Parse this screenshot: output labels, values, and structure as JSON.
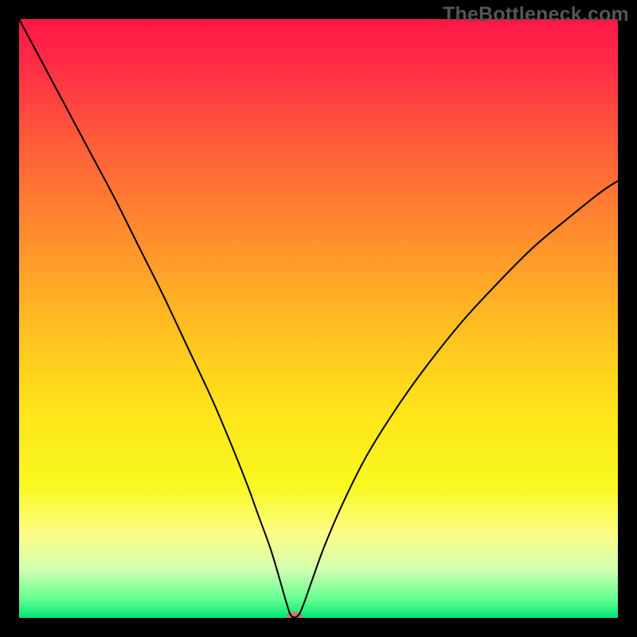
{
  "watermark": "TheBottleneck.com",
  "chart_data": {
    "type": "line",
    "title": "",
    "xlabel": "",
    "ylabel": "",
    "xlim": [
      0,
      100
    ],
    "ylim": [
      0,
      100
    ],
    "grid": false,
    "background_gradient": {
      "type": "vertical",
      "stops": [
        {
          "pos": 0.0,
          "color": "#ff1744"
        },
        {
          "pos": 0.07,
          "color": "#ff2a47"
        },
        {
          "pos": 0.2,
          "color": "#ff5a3a"
        },
        {
          "pos": 0.35,
          "color": "#ff8a2e"
        },
        {
          "pos": 0.5,
          "color": "#ffba22"
        },
        {
          "pos": 0.65,
          "color": "#ffe31a"
        },
        {
          "pos": 0.78,
          "color": "#f8f820"
        },
        {
          "pos": 0.86,
          "color": "#fdfd88"
        },
        {
          "pos": 0.92,
          "color": "#d0ffb0"
        },
        {
          "pos": 0.97,
          "color": "#60ff90"
        },
        {
          "pos": 1.0,
          "color": "#00e676"
        }
      ]
    },
    "series": [
      {
        "name": "bottleneck-curve",
        "color": "#000000",
        "stroke_width": 2,
        "points": [
          {
            "x": 0.0,
            "y": 100.0
          },
          {
            "x": 4.0,
            "y": 92.5
          },
          {
            "x": 8.0,
            "y": 85.0
          },
          {
            "x": 12.0,
            "y": 77.5
          },
          {
            "x": 16.0,
            "y": 70.0
          },
          {
            "x": 20.0,
            "y": 62.0
          },
          {
            "x": 24.0,
            "y": 54.0
          },
          {
            "x": 28.0,
            "y": 45.5
          },
          {
            "x": 32.0,
            "y": 37.0
          },
          {
            "x": 35.0,
            "y": 30.0
          },
          {
            "x": 38.0,
            "y": 22.5
          },
          {
            "x": 40.0,
            "y": 17.0
          },
          {
            "x": 42.0,
            "y": 11.5
          },
          {
            "x": 43.5,
            "y": 6.5
          },
          {
            "x": 44.8,
            "y": 2.0
          },
          {
            "x": 45.5,
            "y": 0.3
          },
          {
            "x": 46.5,
            "y": 0.3
          },
          {
            "x": 47.4,
            "y": 2.0
          },
          {
            "x": 49.0,
            "y": 6.5
          },
          {
            "x": 51.0,
            "y": 12.0
          },
          {
            "x": 54.0,
            "y": 19.0
          },
          {
            "x": 58.0,
            "y": 27.0
          },
          {
            "x": 63.0,
            "y": 35.0
          },
          {
            "x": 68.0,
            "y": 42.0
          },
          {
            "x": 74.0,
            "y": 49.5
          },
          {
            "x": 80.0,
            "y": 56.0
          },
          {
            "x": 86.0,
            "y": 62.0
          },
          {
            "x": 92.0,
            "y": 67.0
          },
          {
            "x": 97.0,
            "y": 71.0
          },
          {
            "x": 100.0,
            "y": 73.0
          }
        ]
      }
    ],
    "annotations": [
      {
        "name": "min-marker",
        "shape": "pill",
        "x": 46.0,
        "y": 0.3,
        "color": "#cc7766"
      }
    ]
  }
}
